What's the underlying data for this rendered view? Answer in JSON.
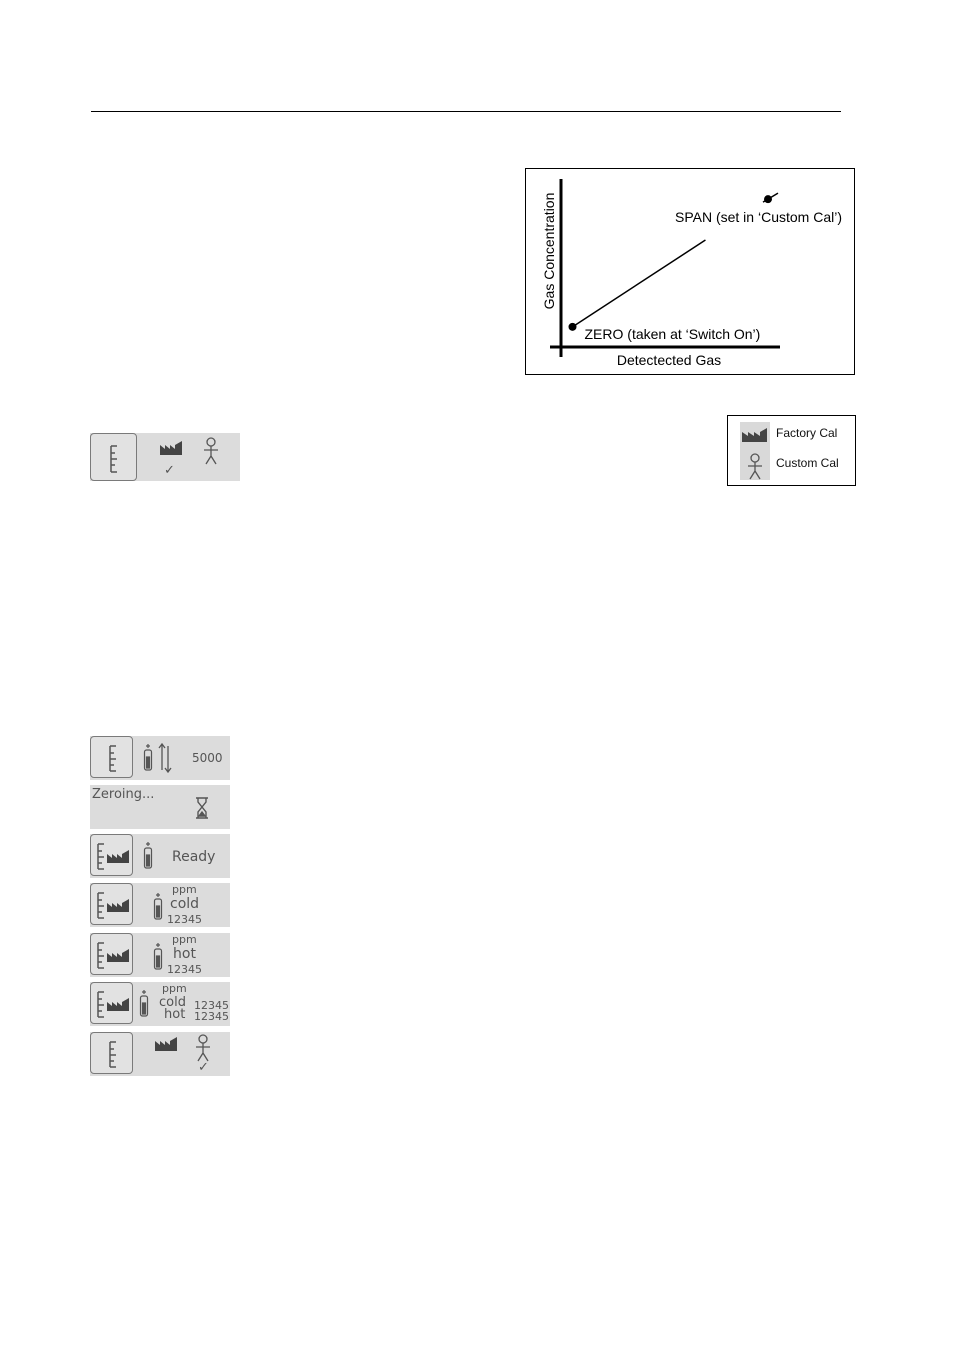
{
  "chart_data": {
    "type": "line",
    "title": "",
    "xlabel": "Detectected Gas",
    "ylabel": "Gas Concentration",
    "grid": false,
    "points": [
      {
        "name": "zero",
        "label": "ZERO (taken at ‘Switch On’)",
        "x": 0.05,
        "y": 0.12
      },
      {
        "name": "span",
        "label": "SPAN (set in ‘Custom Cal’)",
        "x": 0.9,
        "y": 0.88
      }
    ],
    "xlim": [
      0,
      1
    ],
    "ylim": [
      0,
      1
    ]
  },
  "legend": {
    "items": [
      {
        "icon": "factory-icon",
        "label": "Factory Cal"
      },
      {
        "icon": "person-icon",
        "label": "Custom Cal"
      }
    ]
  },
  "screens": {
    "cal_select": {
      "selected": "factory-icon",
      "check": "✓"
    },
    "span_value": {
      "value": "5000"
    },
    "zeroing": {
      "text": "Zeroing...",
      "icon": "hourglass-icon"
    },
    "ready": {
      "text": "Ready"
    },
    "cold": {
      "unit": "ppm",
      "label": "cold",
      "value": "12345"
    },
    "hot": {
      "unit": "ppm",
      "label": "hot",
      "value": "12345"
    },
    "both": {
      "unit": "ppm",
      "cold_label": "cold",
      "cold_value": "12345",
      "hot_label": "hot",
      "hot_value": "12345"
    },
    "custom_select": {
      "selected": "person-icon",
      "check": "✓"
    }
  }
}
